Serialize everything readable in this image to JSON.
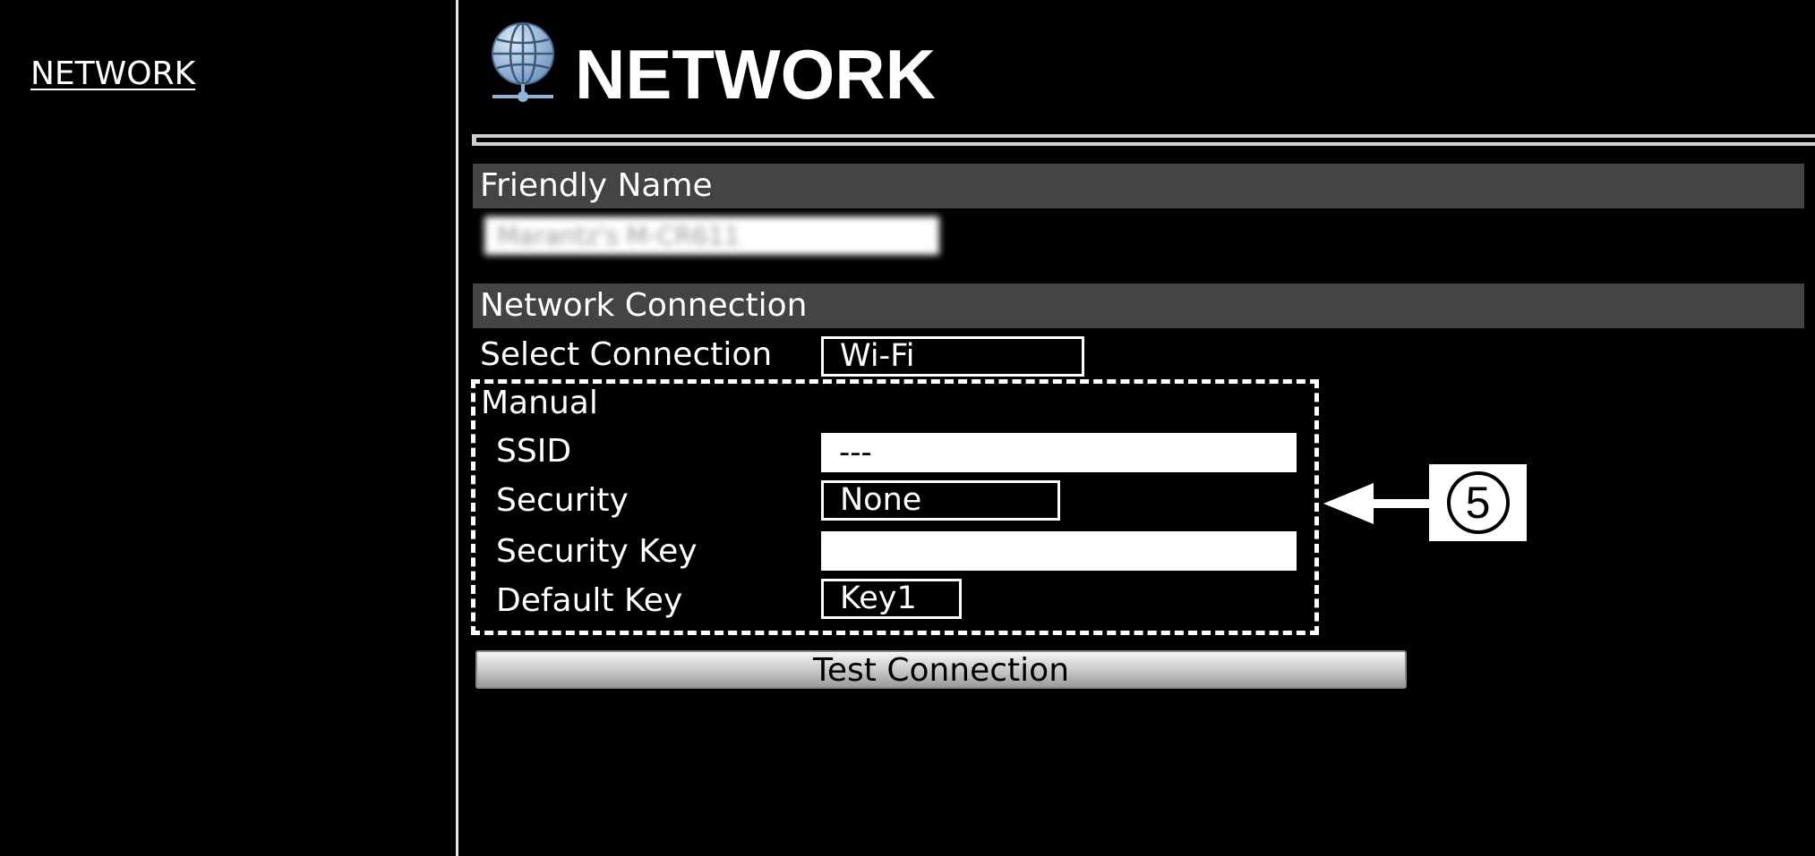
{
  "sidebar": {
    "items": [
      {
        "label": "NETWORK"
      }
    ]
  },
  "header": {
    "title": "NETWORK",
    "icon": "globe-network-icon",
    "icon_color": "#8fb3d8"
  },
  "friendly_name": {
    "label": "Friendly Name",
    "value": "Marantz's M-CR611"
  },
  "network_connection": {
    "label": "Network Connection",
    "select_connection": {
      "label": "Select Connection",
      "value": "Wi-Fi"
    },
    "manual": {
      "label": "Manual",
      "ssid": {
        "label": "SSID",
        "value": "---"
      },
      "security": {
        "label": "Security",
        "value": "None"
      },
      "security_key": {
        "label": "Security Key",
        "value": ""
      },
      "default_key": {
        "label": "Default Key",
        "value": "Key1"
      }
    }
  },
  "test_connection": {
    "label": "Test Connection"
  },
  "callout": {
    "number": "5"
  },
  "colors": {
    "background": "#000000",
    "section_bar": "#444444",
    "text": "#ffffff"
  }
}
